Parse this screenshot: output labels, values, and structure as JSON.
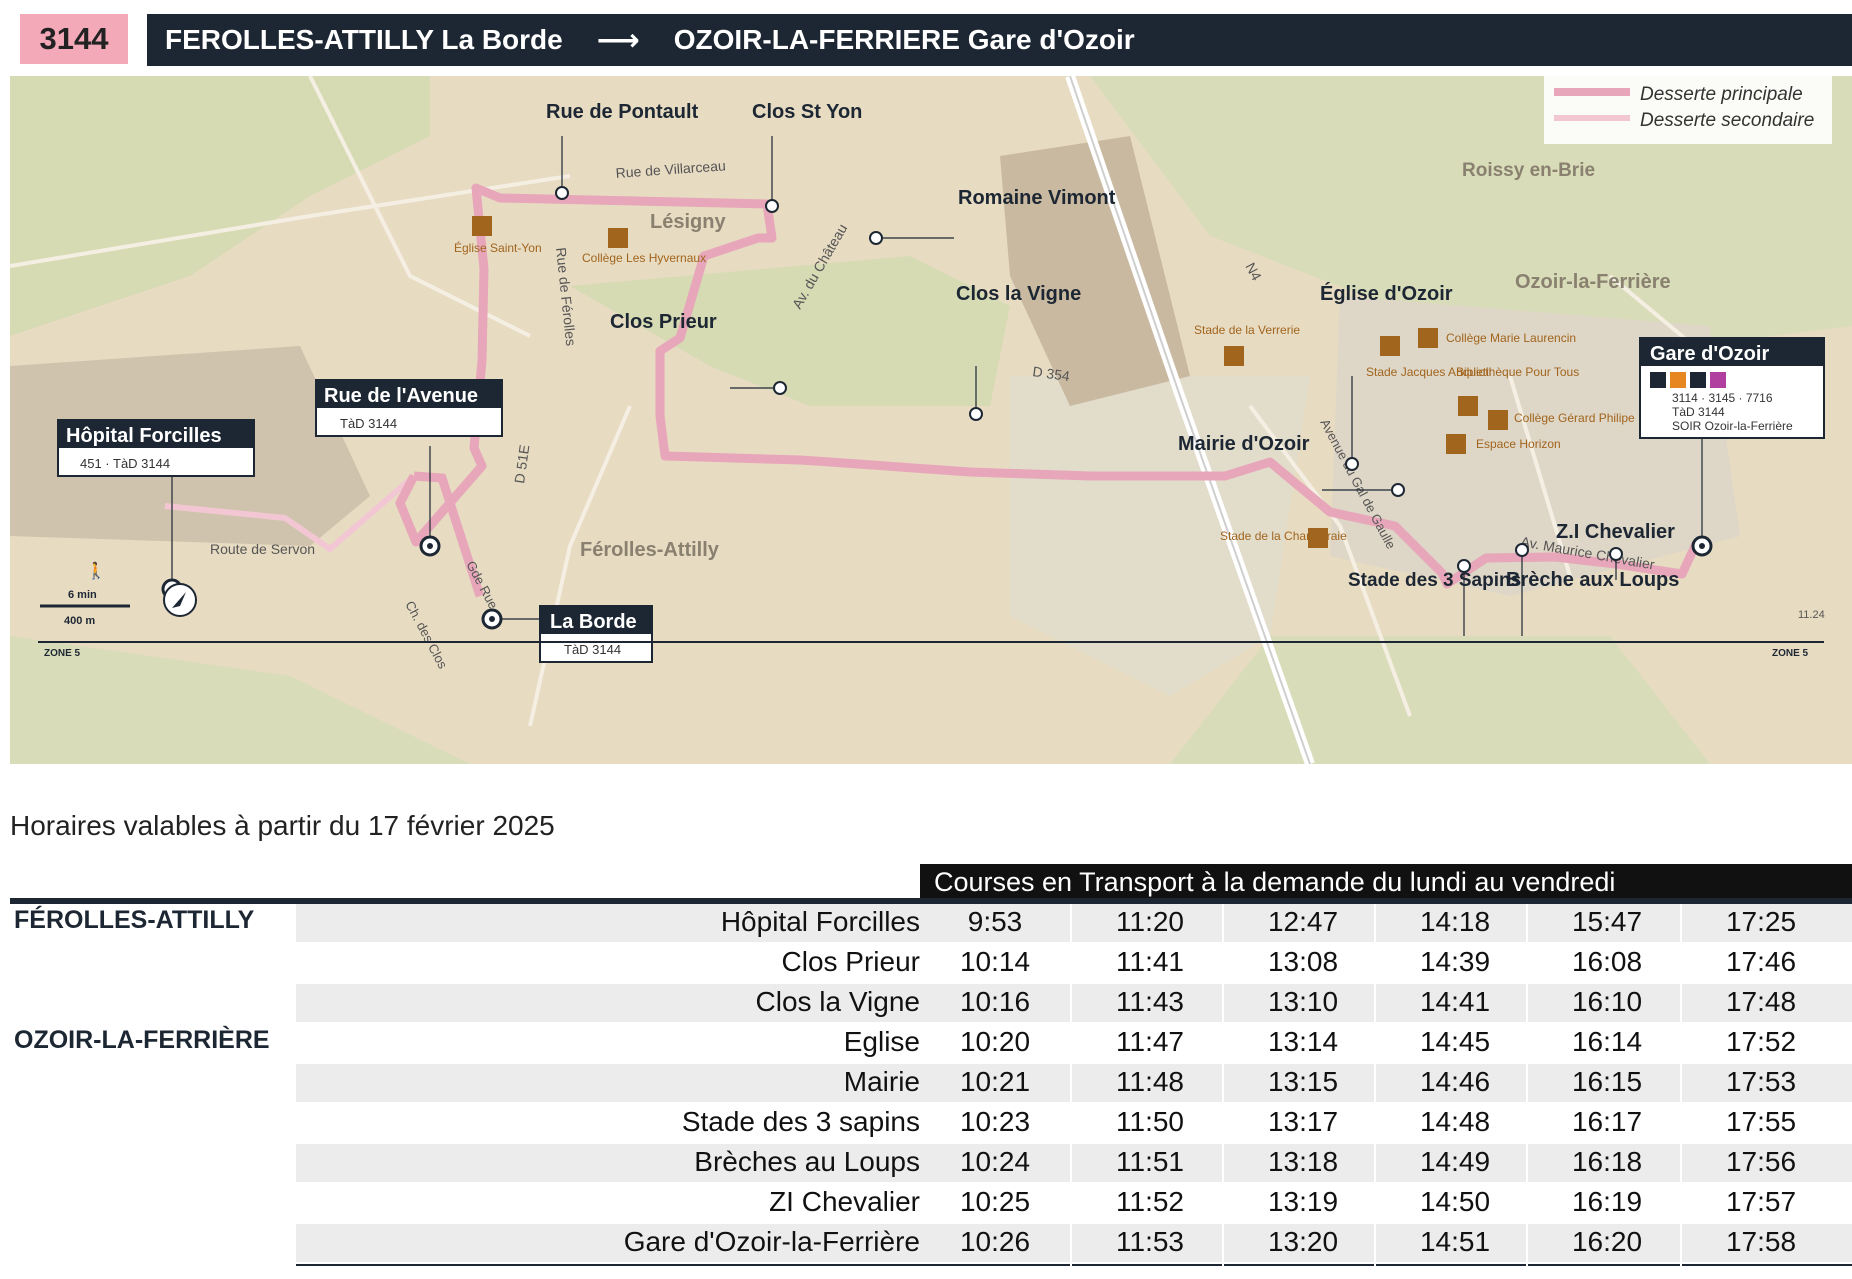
{
  "route": {
    "number": "3144",
    "from": "FEROLLES-ATTILLY La Borde",
    "arrow": "⟶",
    "to": "OZOIR-LA-FERRIERE Gare d'Ozoir"
  },
  "map": {
    "legend": {
      "main": "Desserte principale",
      "secondary": "Desserte secondaire"
    },
    "colors": {
      "route": "#e7a6b9",
      "route_secondary": "#f2c7d3",
      "land": "#e6d8bd",
      "green": "#d5dcb5",
      "dark": "#1d2733"
    },
    "places": [
      "Lésigny",
      "Férolles-Attilly",
      "Roissy en-Brie",
      "Ozoir-la-Ferrière"
    ],
    "roads": [
      "Rue de Villarceau",
      "Av. du Château",
      "Rue de Férolles",
      "D 51E",
      "D 354",
      "N4",
      "Gde Rue",
      "Ch. des Clos",
      "Route de Servon",
      "Avenue du Gal de Gaulle",
      "Av. Maurice Chevalier"
    ],
    "stops": [
      "Rue de Pontault",
      "Clos St Yon",
      "Romaine Vimont",
      "Clos Prieur",
      "Clos la Vigne",
      "Église d'Ozoir",
      "Mairie d'Ozoir",
      "Stade des 3 Sapins",
      "Brèche aux Loups",
      "Z.I Chevalier",
      "Gare d'Ozoir",
      "Rue de l'Avenue",
      "Hôpital Forcilles",
      "La Borde"
    ],
    "stop_boxes": {
      "hopital": {
        "name": "Hôpital Forcilles",
        "lines": "451 · TàD 3144"
      },
      "avenue": {
        "name": "Rue de l'Avenue",
        "lines": "TàD 3144"
      },
      "borde": {
        "name": "La Borde",
        "lines": "TàD 3144"
      },
      "gare": {
        "name": "Gare d'Ozoir",
        "lines": "3114 · 3145 · 7716",
        "lines2": "TàD 3144",
        "lines3": "SOIR Ozoir-la-Ferrière"
      }
    },
    "pois": [
      "Église Saint-Yon",
      "Collège Les Hyvernaux",
      "Stade de la Verrerie",
      "Collège Marie Laurencin",
      "Stade Jacques Anquetil",
      "Bibliothèque Pour Tous",
      "Collège Gérard Philipe",
      "Espace Horizon",
      "Stade de la Charmeraie"
    ],
    "scale": {
      "walk": "6 min",
      "distance": "400 m"
    },
    "zone_left": "ZONE 5",
    "zone_right": "ZONE 5",
    "credit": "11.24"
  },
  "validity": "Horaires valables à partir du 17 février 2025",
  "timetable": {
    "banner": "Courses en Transport à la demande du lundi au vendredi",
    "rows": [
      {
        "town": "FÉROLLES-ATTILLY",
        "stop": "Hôpital Forcilles",
        "times": [
          "9:53",
          "11:20",
          "12:47",
          "14:18",
          "15:47",
          "17:25"
        ]
      },
      {
        "town": "",
        "stop": "Clos Prieur",
        "times": [
          "10:14",
          "11:41",
          "13:08",
          "14:39",
          "16:08",
          "17:46"
        ]
      },
      {
        "town": "",
        "stop": "Clos la Vigne",
        "times": [
          "10:16",
          "11:43",
          "13:10",
          "14:41",
          "16:10",
          "17:48"
        ]
      },
      {
        "town": "OZOIR-LA-FERRIÈRE",
        "stop": "Eglise",
        "times": [
          "10:20",
          "11:47",
          "13:14",
          "14:45",
          "16:14",
          "17:52"
        ]
      },
      {
        "town": "",
        "stop": "Mairie",
        "times": [
          "10:21",
          "11:48",
          "13:15",
          "14:46",
          "16:15",
          "17:53"
        ]
      },
      {
        "town": "",
        "stop": "Stade des 3 sapins",
        "times": [
          "10:23",
          "11:50",
          "13:17",
          "14:48",
          "16:17",
          "17:55"
        ]
      },
      {
        "town": "",
        "stop": "Brèches au Loups",
        "times": [
          "10:24",
          "11:51",
          "13:18",
          "14:49",
          "16:18",
          "17:56"
        ]
      },
      {
        "town": "",
        "stop": "ZI Chevalier",
        "times": [
          "10:25",
          "11:52",
          "13:19",
          "14:50",
          "16:19",
          "17:57"
        ]
      },
      {
        "town": "",
        "stop": "Gare d'Ozoir-la-Ferrière",
        "times": [
          "10:26",
          "11:53",
          "13:20",
          "14:51",
          "16:20",
          "17:58"
        ]
      }
    ]
  }
}
